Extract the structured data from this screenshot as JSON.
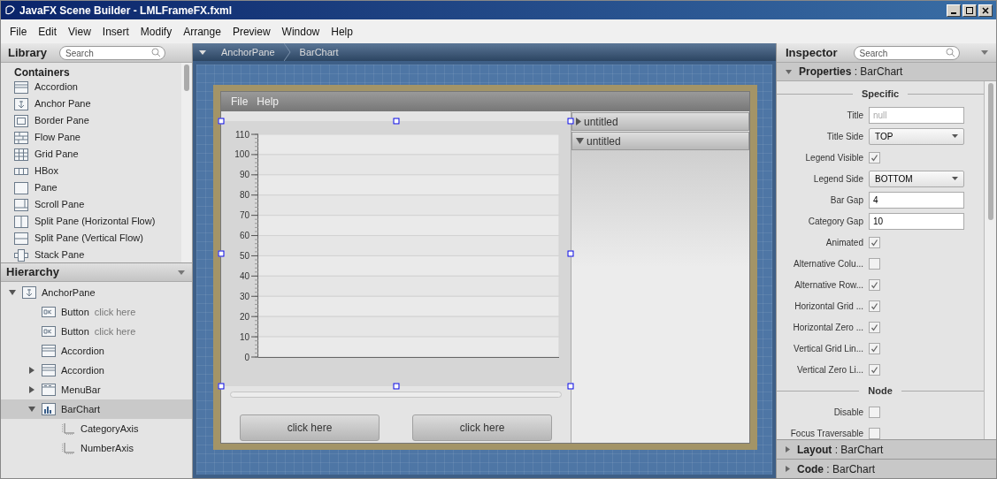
{
  "window": {
    "title": "JavaFX Scene Builder - LMLFrameFX.fxml"
  },
  "menu": [
    "File",
    "Edit",
    "View",
    "Insert",
    "Modify",
    "Arrange",
    "Preview",
    "Window",
    "Help"
  ],
  "library": {
    "title": "Library",
    "search": {
      "placeholder": "Search"
    },
    "section": "Containers",
    "items": [
      {
        "label": "Accordion",
        "kind": "accordion"
      },
      {
        "label": "Anchor Pane",
        "kind": "anchor"
      },
      {
        "label": "Border Pane",
        "kind": "border"
      },
      {
        "label": "Flow Pane",
        "kind": "flow"
      },
      {
        "label": "Grid Pane",
        "kind": "grid"
      },
      {
        "label": "HBox",
        "kind": "hbox"
      },
      {
        "label": "Pane",
        "kind": "pane"
      },
      {
        "label": "Scroll Pane",
        "kind": "scroll"
      },
      {
        "label": "Split Pane (Horizontal Flow)",
        "kind": "splith"
      },
      {
        "label": "Split Pane (Vertical Flow)",
        "kind": "splitv"
      },
      {
        "label": "Stack Pane",
        "kind": "stack"
      }
    ]
  },
  "hierarchy": {
    "title": "Hierarchy",
    "items": [
      {
        "label": "AnchorPane",
        "kind": "anchor",
        "expanded": true,
        "selected": false,
        "children": [
          {
            "label": "Button",
            "detail": "click here",
            "kind": "button",
            "selected": false
          },
          {
            "label": "Button",
            "detail": "click here",
            "kind": "button",
            "selected": false
          },
          {
            "label": "Accordion",
            "kind": "accordion",
            "selected": false
          },
          {
            "label": "Accordion",
            "kind": "accordion",
            "expanded": false,
            "selected": false
          },
          {
            "label": "MenuBar",
            "kind": "menubar",
            "expanded": false,
            "selected": false
          },
          {
            "label": "BarChart",
            "kind": "chart",
            "expanded": true,
            "selected": true,
            "children": [
              {
                "label": "CategoryAxis",
                "kind": "axis",
                "selected": false
              },
              {
                "label": "NumberAxis",
                "kind": "axis",
                "selected": false
              }
            ]
          }
        ]
      }
    ]
  },
  "breadcrumb": [
    "AnchorPane",
    "BarChart"
  ],
  "canvas": {
    "menu": [
      "File",
      "Help"
    ],
    "chart": {
      "y_axis_labels": [
        "110",
        "100",
        "90",
        "80",
        "70",
        "60",
        "50",
        "40",
        "30",
        "20",
        "10",
        "0"
      ]
    },
    "accordion": [
      {
        "title": "untitled",
        "expanded": false
      },
      {
        "title": "untitled",
        "expanded": true
      }
    ],
    "buttons": [
      "click here",
      "click here"
    ]
  },
  "inspector": {
    "title": "Inspector",
    "search": {
      "placeholder": "Search"
    },
    "properties": {
      "label": "**Properties** : BarChart",
      "expanded": true,
      "rows": [
        {
          "kind": "section",
          "label": "Specific"
        },
        {
          "kind": "text",
          "label": "Title",
          "placeholder": "null"
        },
        {
          "kind": "choice",
          "label": "Title Side",
          "value": "TOP"
        },
        {
          "kind": "check",
          "label": "Legend Visible",
          "checked": true
        },
        {
          "kind": "choice",
          "label": "Legend Side",
          "value": "BOTTOM"
        },
        {
          "kind": "text",
          "label": "Bar Gap",
          "value": "4"
        },
        {
          "kind": "text",
          "label": "Category Gap",
          "value": "10"
        },
        {
          "kind": "check",
          "label": "Animated",
          "checked": true
        },
        {
          "kind": "check",
          "label": "Alternative Colu...",
          "checked": false
        },
        {
          "kind": "check",
          "label": "Alternative Row...",
          "checked": true
        },
        {
          "kind": "check",
          "label": "Horizontal Grid ...",
          "checked": true
        },
        {
          "kind": "check",
          "label": "Horizontal Zero ...",
          "checked": true
        },
        {
          "kind": "check",
          "label": "Vertical Grid Lin...",
          "checked": true
        },
        {
          "kind": "check",
          "label": "Vertical Zero Li...",
          "checked": true
        },
        {
          "kind": "section",
          "label": "Node"
        },
        {
          "kind": "check",
          "label": "Disable",
          "checked": false
        },
        {
          "kind": "check",
          "label": "Focus Traversable",
          "checked": false
        }
      ]
    },
    "panels": [
      {
        "label": "**Layout** : BarChart",
        "expanded": false
      },
      {
        "label": "**Code** : BarChart",
        "expanded": false
      }
    ]
  }
}
